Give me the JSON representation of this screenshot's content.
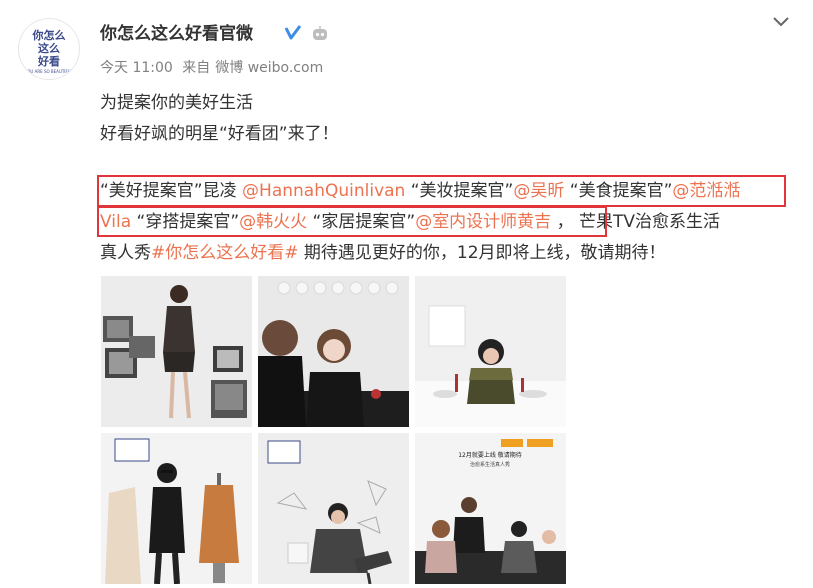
{
  "post": {
    "author": "你怎么这么好看官微",
    "time": "今天 11:00",
    "source_prefix": "来自",
    "source": "微博 weibo.com",
    "avatar_text_lines": [
      "你怎么",
      "这么",
      "好看"
    ],
    "avatar_subtext": "YOU ARE SO BEAUTIFUL"
  },
  "text": {
    "line1": "为提案你的美好生活",
    "line2": "好看好飒的明星“好看团”来了！",
    "l3_a": "“美好提案官”昆凌 ",
    "l3_m1": "@HannahQuinlivan",
    "l3_b": " “美妆提案官”",
    "l3_m2": "@吴昕",
    "l3_c": " “美食提案官”",
    "l3_m3": "@范湉湉",
    "l4_m3b": "Vila",
    "l4_a": " “穿搭提案官”",
    "l4_m4": "@韩火火",
    "l4_b": " “家居提案官”",
    "l4_m5": "@室内设计师黄吉",
    "l4_c": " ，  芒果TV治愈系生活",
    "l5_a": "真人秀",
    "l5_h": "#你怎么这么好看#",
    "l5_b": " 期待遇见更好的你，12月即将上线，敬请期待！"
  },
  "photos": [
    {
      "name": "photo-1"
    },
    {
      "name": "photo-2"
    },
    {
      "name": "photo-3"
    },
    {
      "name": "photo-4"
    },
    {
      "name": "photo-5"
    },
    {
      "name": "photo-6"
    }
  ],
  "photo6": {
    "line1": "12月就要上线  敬请期待",
    "line2": "治愈系生活真人秀"
  },
  "colors": {
    "mention": "#eb7350",
    "highlight_box": "#e0353b",
    "verify_badge": "#3a8ee6"
  }
}
